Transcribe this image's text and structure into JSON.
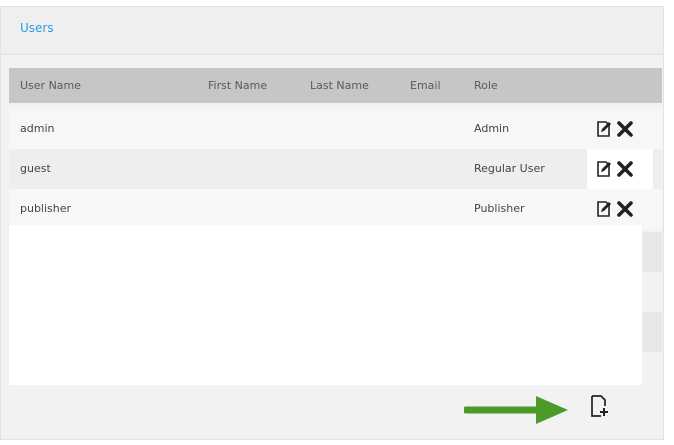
{
  "panel": {
    "title": "Users"
  },
  "table": {
    "columns": [
      "User Name",
      "First Name",
      "Last Name",
      "Email",
      "Role"
    ],
    "rows": [
      {
        "username": "admin",
        "first_name": "",
        "last_name": "",
        "email": "",
        "role": "Admin"
      },
      {
        "username": "guest",
        "first_name": "",
        "last_name": "",
        "email": "",
        "role": "Regular User"
      },
      {
        "username": "publisher",
        "first_name": "",
        "last_name": "",
        "email": "",
        "role": "Publisher"
      }
    ]
  },
  "icons": {
    "edit": "edit-icon",
    "delete": "delete-icon",
    "add": "add-user-icon",
    "arrow": "arrow-right-indicator"
  },
  "colors": {
    "title": "#2f9ae3",
    "header_bg": "#c6c6c6",
    "arrow": "#4c9a2a"
  }
}
